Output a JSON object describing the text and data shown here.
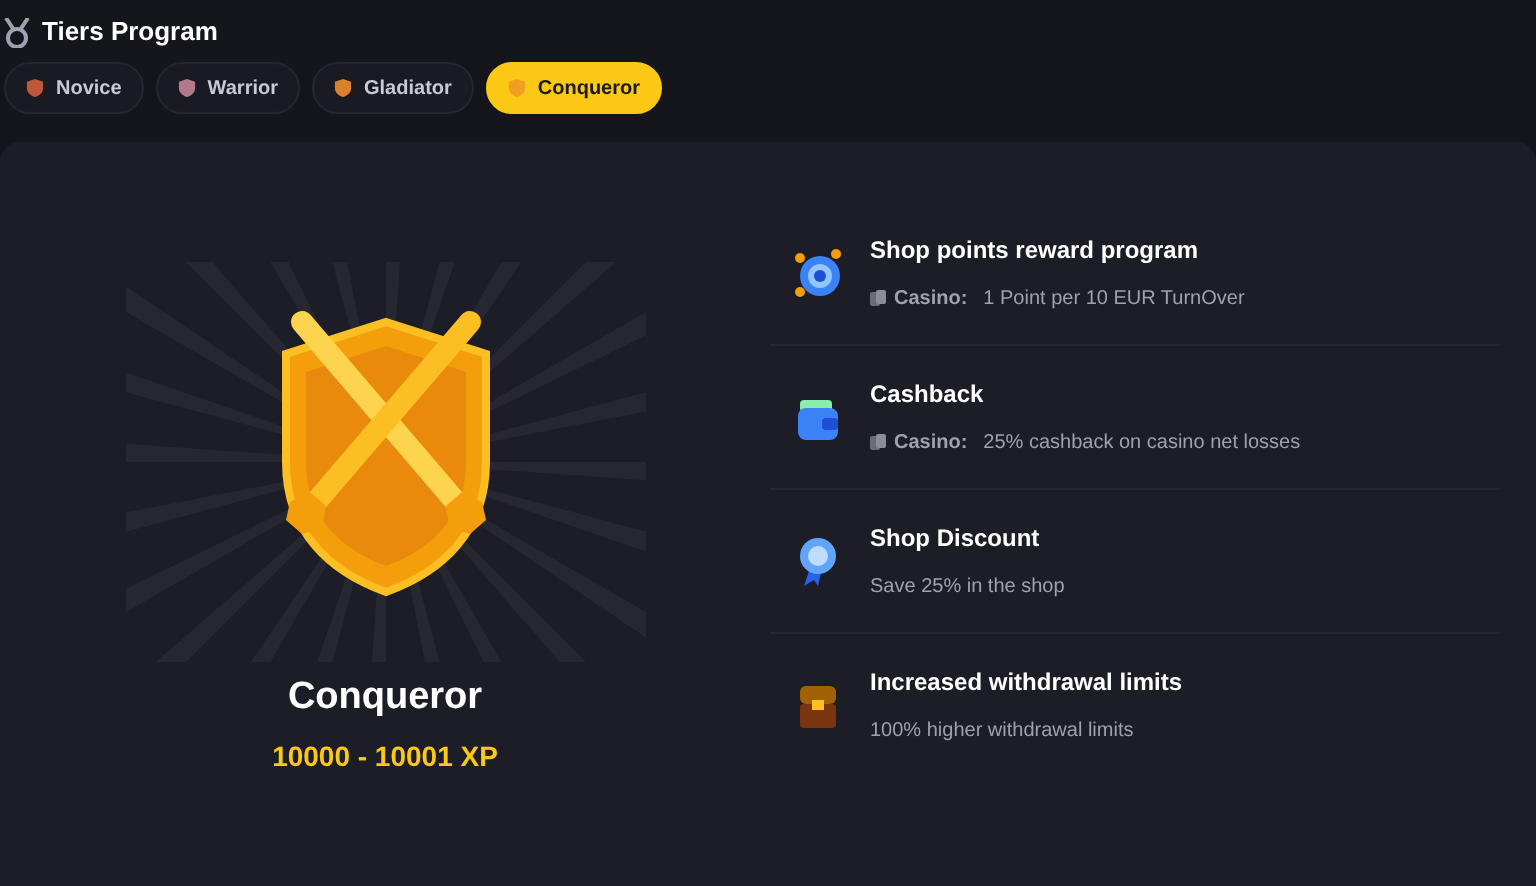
{
  "header": {
    "title": "Tiers Program"
  },
  "tabs": [
    {
      "label": "Novice",
      "selected": false,
      "color": "#c0573a"
    },
    {
      "label": "Warrior",
      "selected": false,
      "color": "#b07a8a"
    },
    {
      "label": "Gladiator",
      "selected": false,
      "color": "#d9822b"
    },
    {
      "label": "Conqueror",
      "selected": true,
      "color": "#f0a020"
    }
  ],
  "tier": {
    "name": "Conqueror",
    "xp": "10000 - 10001 XP"
  },
  "benefits": [
    {
      "kind": "casino",
      "title": "Shop points reward program",
      "label": "Casino:",
      "text": "1 Point per 10 EUR TurnOver"
    },
    {
      "kind": "casino",
      "title": "Cashback",
      "label": "Casino:",
      "text": "25% cashback on casino net losses"
    },
    {
      "kind": "plain",
      "title": "Shop Discount",
      "text": "Save 25% in the shop"
    },
    {
      "kind": "plain",
      "title": "Increased withdrawal limits",
      "text": "100% higher withdrawal limits"
    }
  ]
}
